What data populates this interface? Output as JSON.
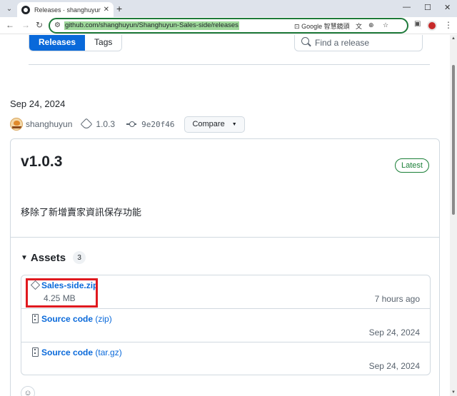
{
  "browser": {
    "tab_title": "Releases · shanghuyun/Shang",
    "url": "github.com/shanghuyun/Shanghuyun-Sales-side/releases",
    "translate_label": "Google 智慧鏡頭",
    "icons": [
      "tab-search-icon",
      "github-favicon",
      "close-icon",
      "plus-icon",
      "minimize-icon",
      "maximize-icon",
      "window-close-icon",
      "back-icon",
      "forward-icon",
      "reload-icon",
      "site-info-icon",
      "lens-icon",
      "translate-icon",
      "zoom-icon",
      "star-icon",
      "extensions-icon",
      "kebab-menu-icon"
    ]
  },
  "releases_nav": {
    "tabs": [
      "Releases",
      "Tags"
    ],
    "active_tab": "Releases",
    "search_placeholder": "Find a release"
  },
  "release": {
    "date": "Sep 24, 2024",
    "author": "shanghuyun",
    "tag": "1.0.3",
    "commit": "9e20f46",
    "compare_label": "Compare",
    "version": "v1.0.3",
    "badge": "Latest",
    "notes": "移除了新增賣家資訊保存功能",
    "badge_color": "#1a7f37",
    "accent_color": "#0969da"
  },
  "assets": {
    "title": "Assets",
    "count": "3",
    "items": [
      {
        "name": "Sales-side.zip",
        "suffix": "",
        "size": "4.25 MB",
        "date": "7 hours ago"
      },
      {
        "name": "Source code",
        "suffix": "(zip)",
        "size": "",
        "date": "Sep 24, 2024"
      },
      {
        "name": "Source code",
        "suffix": "(tar.gz)",
        "size": "",
        "date": "Sep 24, 2024"
      }
    ],
    "highlight_color": "#e0191f"
  }
}
